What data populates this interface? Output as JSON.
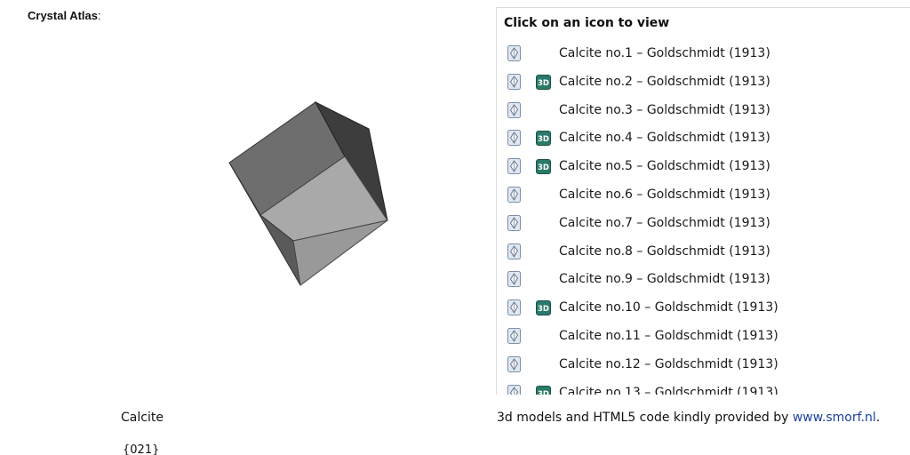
{
  "atlas": {
    "label": "Crystal Atlas",
    "colon": ":"
  },
  "panel": {
    "header": "Click on an icon to view",
    "entries": [
      {
        "label": "Calcite no.1 – Goldschmidt (1913)",
        "has_3d": false
      },
      {
        "label": "Calcite no.2 – Goldschmidt (1913)",
        "has_3d": true
      },
      {
        "label": "Calcite no.3 – Goldschmidt (1913)",
        "has_3d": false
      },
      {
        "label": "Calcite no.4 – Goldschmidt (1913)",
        "has_3d": true
      },
      {
        "label": "Calcite no.5 – Goldschmidt (1913)",
        "has_3d": true
      },
      {
        "label": "Calcite no.6 – Goldschmidt (1913)",
        "has_3d": false
      },
      {
        "label": "Calcite no.7 – Goldschmidt (1913)",
        "has_3d": false
      },
      {
        "label": "Calcite no.8 – Goldschmidt (1913)",
        "has_3d": false
      },
      {
        "label": "Calcite no.9 – Goldschmidt (1913)",
        "has_3d": false
      },
      {
        "label": "Calcite no.10 – Goldschmidt (1913)",
        "has_3d": true
      },
      {
        "label": "Calcite no.11 – Goldschmidt (1913)",
        "has_3d": false
      },
      {
        "label": "Calcite no.12 – Goldschmidt (1913)",
        "has_3d": false
      },
      {
        "label": "Calcite no.13 – Goldschmidt (1913)",
        "has_3d": true
      }
    ],
    "icon_2d": "crystal-drawing-icon",
    "icon_3d": "3d-model-icon",
    "icon_3d_text": "3D"
  },
  "mineral": {
    "name": "Calcite",
    "form": "{021}"
  },
  "credit": {
    "text": "3d models and HTML5 code kindly provided by ",
    "link": "www.smorf.nl",
    "suffix": "."
  },
  "colors": {
    "link": "#1d3f9e",
    "crystal_top": "#a8a8a8",
    "crystal_left": "#666666",
    "crystal_right": "#3f3f3f",
    "crystal_front": "#9a9a9a",
    "icon_3d_bg": "#2a7a6a"
  }
}
